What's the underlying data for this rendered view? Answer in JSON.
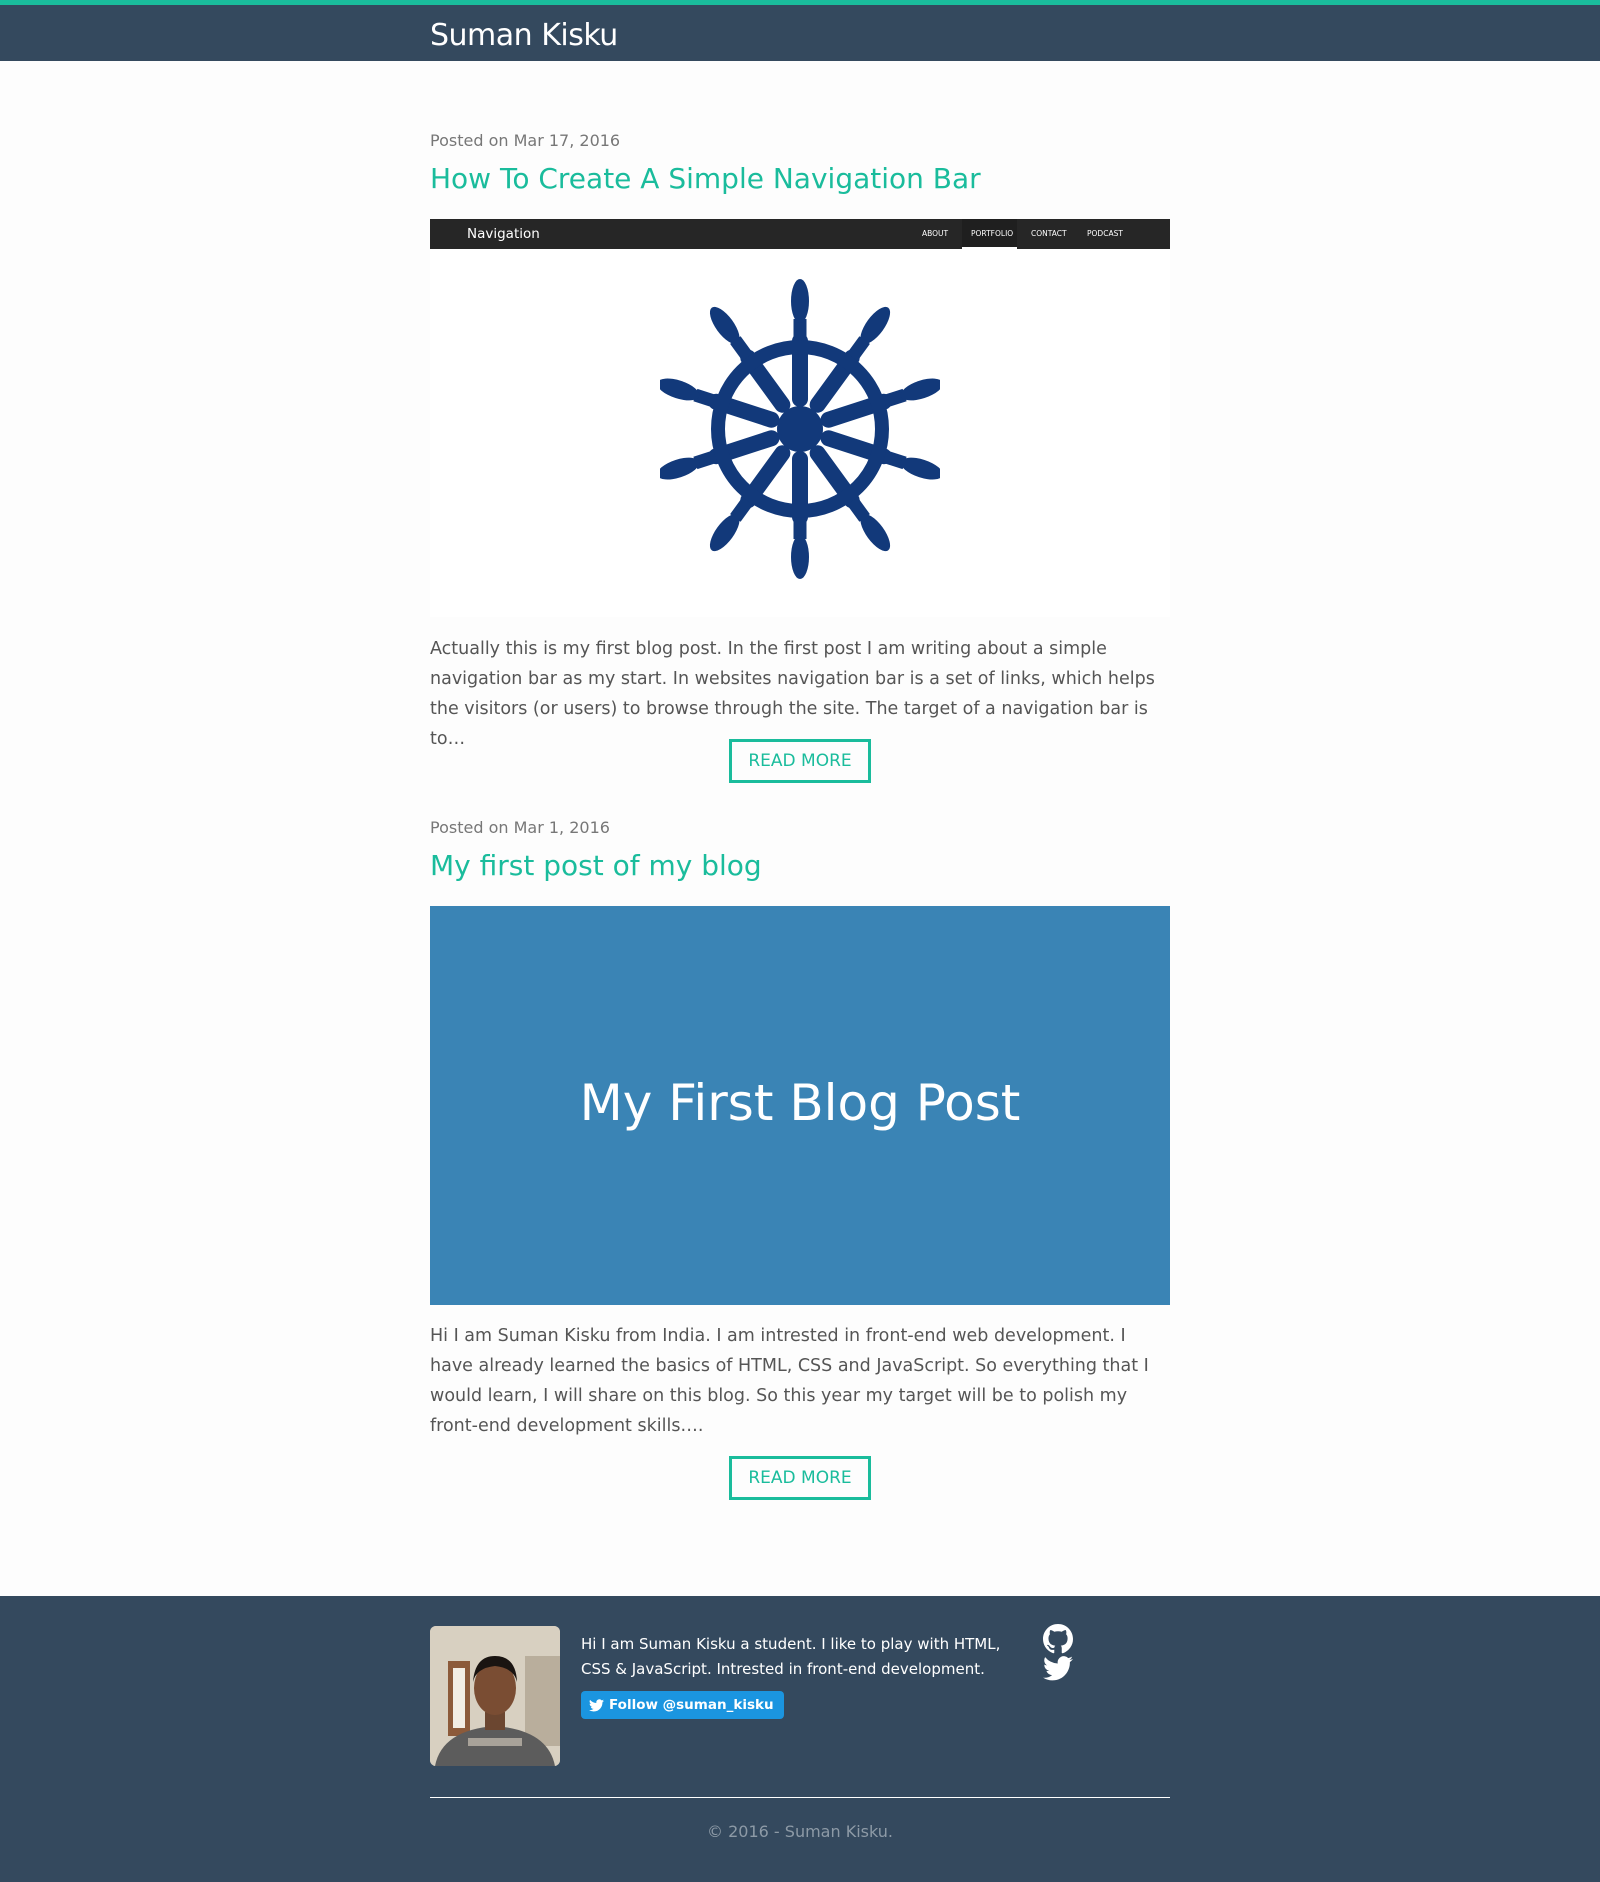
{
  "header": {
    "site_title": "Suman Kisku"
  },
  "posts": [
    {
      "date": "Posted on Mar 17, 2016",
      "title": "How To Create A Simple Navigation Bar",
      "image": {
        "nav_brand": "Navigation",
        "nav_links": [
          "ABOUT",
          "PORTFOLIO",
          "CONTACT",
          "PODCAST"
        ],
        "icon": "ship-wheel-icon"
      },
      "excerpt": "Actually this is my first blog post. In the first post I am writing about a simple navigation bar as my start. In websites navigation bar is a set of links, which helps the visitors (or users) to browse through the site. The target of a navigation bar is to…",
      "read_more": "READ MORE"
    },
    {
      "date": "Posted on Mar 1, 2016",
      "title": "My first post of my blog",
      "image": {
        "text": "My First Blog Post"
      },
      "excerpt": "Hi I am Suman Kisku from India. I am intrested in front-end web development. I have already learned the basics of HTML, CSS and JavaScript. So everything that I would learn, I will share on this blog. So this year my target will be to polish my front-end development skills….",
      "read_more": "READ MORE"
    }
  ],
  "footer": {
    "bio": "Hi I am Suman Kisku a student. I like to play with HTML, CSS & JavaScript. Intrested in front-end development.",
    "twitter_follow": "Follow @suman_kisku",
    "social_icons": [
      "github-icon",
      "twitter-icon"
    ],
    "copyright": "© 2016 - Suman Kisku."
  },
  "colors": {
    "accent": "#1abc9c",
    "header_bg": "#34495e",
    "post_image_bg": "#3a84b5",
    "wheel": "#12397a",
    "twitter": "#1b95e0"
  }
}
